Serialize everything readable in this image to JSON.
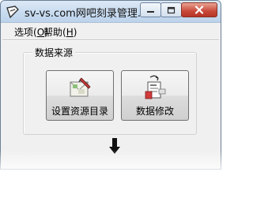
{
  "window": {
    "title": "sv-vs.com网吧刻录管理...",
    "controls": {
      "minimize": "minimize-icon",
      "maximize": "maximize-icon",
      "close": "close-icon"
    }
  },
  "menu": {
    "items": [
      {
        "label": "选项",
        "accel": "O"
      },
      {
        "label": "帮助",
        "accel": "H"
      }
    ]
  },
  "group": {
    "label": "数据来源",
    "buttons": [
      {
        "label": "设置资源目录",
        "icon": "envelope-pen-icon"
      },
      {
        "label": "数据修改",
        "icon": "edit-document-icon"
      }
    ]
  },
  "flow": {
    "icon": "down-arrow-icon"
  },
  "colors": {
    "close_button": "#c8483a",
    "titlebar": "#c9dcf0",
    "window_bg": "#f0f0f0"
  }
}
